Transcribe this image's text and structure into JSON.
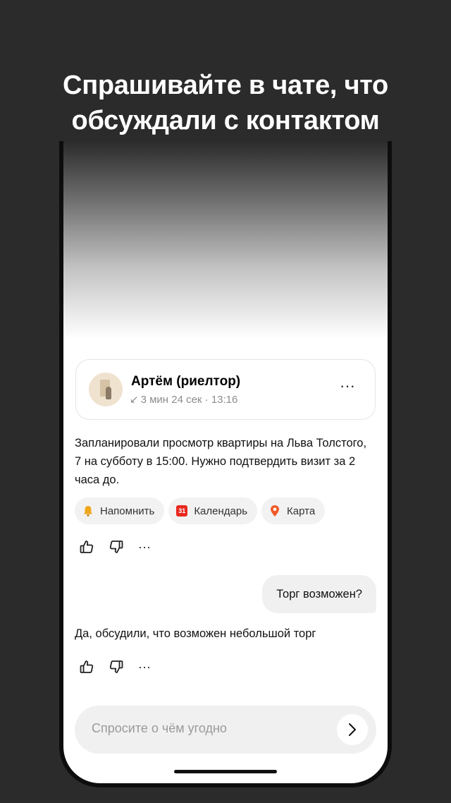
{
  "headline": "Спрашивайте в чате, что\nобсуждали с контактом",
  "contact": {
    "name": "Артём (риелтор)",
    "call_arrow": "↙",
    "call_meta": "3 мин 24 сек · 13:16",
    "more": "···"
  },
  "summary": "Запланировали просмотр квартиры на Льва Толстого, 7 на субботу в 15:00. Нужно подтвердить визит за 2 часа до.",
  "chips": [
    {
      "label": "Напомнить",
      "icon": "bell-icon"
    },
    {
      "label": "Календарь",
      "icon": "calendar-icon",
      "icon_text": "31"
    },
    {
      "label": "Карта",
      "icon": "map-pin-icon"
    }
  ],
  "feedback": {
    "more": "···"
  },
  "user_message": "Торг возможен?",
  "assistant_answer": "Да, обсудили, что возможен небольшой торг",
  "input": {
    "placeholder": "Спросите о чём угодно"
  },
  "colors": {
    "background": "#2b2b2b",
    "calendar_red": "#e8281e",
    "pin_orange": "#f05a28",
    "bell_gold": "#f0a71c",
    "chip_bg": "#f2f2f2"
  }
}
